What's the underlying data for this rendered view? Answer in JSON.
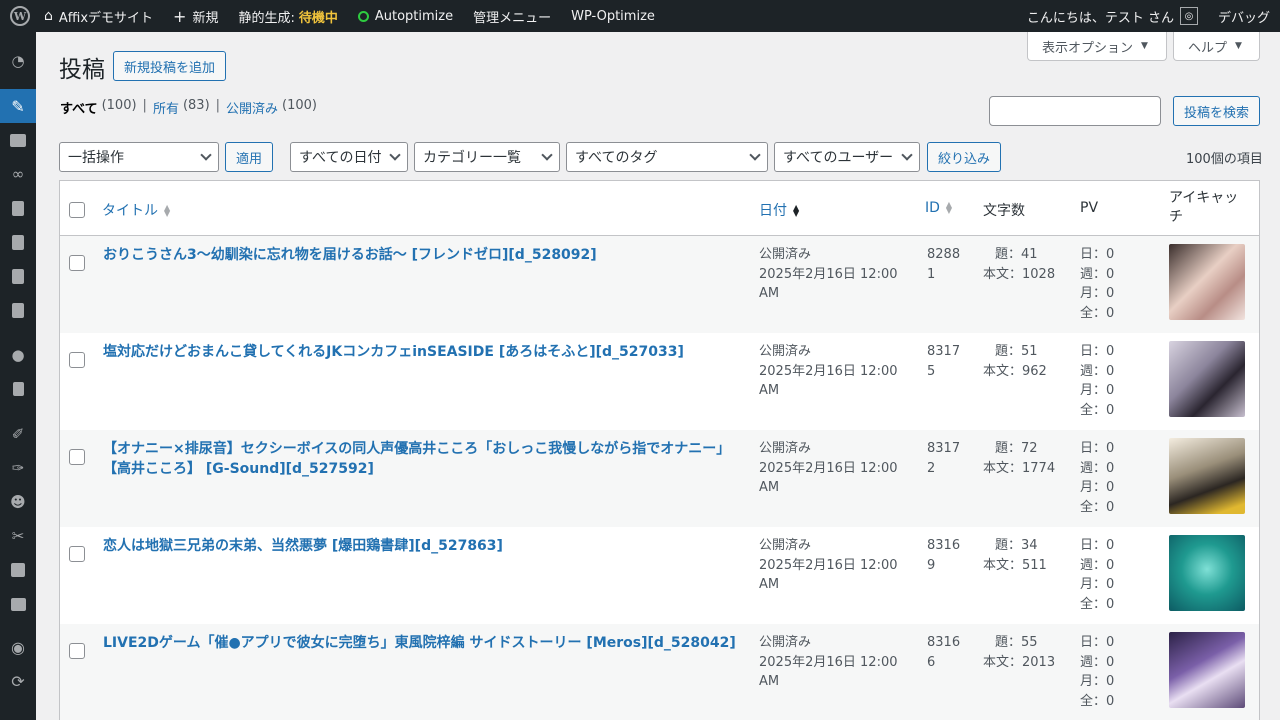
{
  "adminbar": {
    "site_name": "Affixデモサイト",
    "new_label": "新規",
    "static_label": "静的生成:",
    "static_status": "待機中",
    "autoptimize": "Autoptimize",
    "admin_menu": "管理メニュー",
    "wp_optimize": "WP-Optimize",
    "greeting": "こんにちは、テスト さん",
    "debug": "デバッグ"
  },
  "screen_meta": {
    "options": "表示オプション",
    "help": "ヘルプ"
  },
  "page": {
    "title": "投稿",
    "add_new": "新規投稿を追加"
  },
  "views": [
    {
      "label": "すべて",
      "count": "(100)"
    },
    {
      "label": "所有",
      "count": "(83)"
    },
    {
      "label": "公開済み",
      "count": "(100)"
    }
  ],
  "search": {
    "placeholder": "",
    "button": "投稿を検索"
  },
  "filters": {
    "bulk": "一括操作",
    "apply": "適用",
    "dates": "すべての日付",
    "categories": "カテゴリー一覧",
    "tags": "すべてのタグ",
    "users": "すべてのユーザー",
    "filter": "絞り込み",
    "count": "100個の項目"
  },
  "table": {
    "headers": {
      "title": "タイトル",
      "date": "日付",
      "id": "ID",
      "wordcount": "文字数",
      "pv": "PV",
      "thumb": "アイキャッチ"
    },
    "rows": [
      {
        "title": "おりこうさん3〜幼馴染に忘れ物を届けるお話〜 [フレンドゼロ][d_528092]",
        "status": "公開済み",
        "date": "2025年2月16日 12:00 AM",
        "id": "82881",
        "wc_title": "題：41",
        "wc_body": "本文：1028",
        "pv_day": "日：0",
        "pv_week": "週：0",
        "pv_month": "月：0",
        "pv_all": "全：0",
        "thumb_color": "#c9a9a3"
      },
      {
        "title": "塩対応だけどおまんこ貸してくれるJKコンカフェinSEASIDE [あろはそふと][d_527033]",
        "status": "公開済み",
        "date": "2025年2月16日 12:00 AM",
        "id": "83175",
        "wc_title": "題：51",
        "wc_body": "本文：962",
        "pv_day": "日：0",
        "pv_week": "週：0",
        "pv_month": "月：0",
        "pv_all": "全：0",
        "thumb_color": "#a9a3b8"
      },
      {
        "title": "【オナニー×排尿音】セクシーボイスの同人声優高井こころ「おしっこ我慢しながら指でオナニー」【高井こころ】 [G-Sound][d_527592]",
        "status": "公開済み",
        "date": "2025年2月16日 12:00 AM",
        "id": "83172",
        "wc_title": "題：72",
        "wc_body": "本文：1774",
        "pv_day": "日：0",
        "pv_week": "週：0",
        "pv_month": "月：0",
        "pv_all": "全：0",
        "thumb_color": "#6b6254"
      },
      {
        "title": "恋人は地獄三兄弟の末弟、当然悪夢 [爆田鶏書肆][d_527863]",
        "status": "公開済み",
        "date": "2025年2月16日 12:00 AM",
        "id": "83169",
        "wc_title": "題：34",
        "wc_body": "本文：511",
        "pv_day": "日：0",
        "pv_week": "週：0",
        "pv_month": "月：0",
        "pv_all": "全：0",
        "thumb_color": "#1f9a90"
      },
      {
        "title": "LIVE2Dゲーム「催●アプリで彼女に完堕ち」東風院梓編 サイドストーリー [Meros][d_528042]",
        "status": "公開済み",
        "date": "2025年2月16日 12:00 AM",
        "id": "83166",
        "wc_title": "題：55",
        "wc_body": "本文：2013",
        "pv_day": "日：0",
        "pv_week": "週：0",
        "pv_month": "月：0",
        "pv_all": "全：0",
        "thumb_color": "#5d4b78"
      }
    ]
  }
}
